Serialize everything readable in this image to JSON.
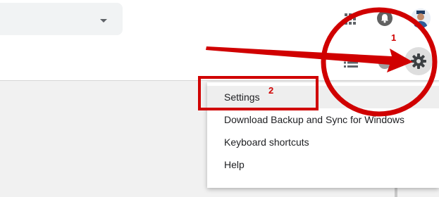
{
  "header": {
    "icons": [
      "chevron-down-icon",
      "apps-icon",
      "bell-icon",
      "avatar",
      "list-icon",
      "gear-icon"
    ]
  },
  "settings_menu": {
    "items": [
      {
        "label": "Settings",
        "active": true
      },
      {
        "label": "Download Backup and Sync for Windows",
        "active": false
      },
      {
        "label": "Keyboard shortcuts",
        "active": false
      },
      {
        "label": "Help",
        "active": false
      }
    ]
  },
  "annotations": {
    "step1": "1",
    "step2": "2",
    "color": "#d00000"
  }
}
